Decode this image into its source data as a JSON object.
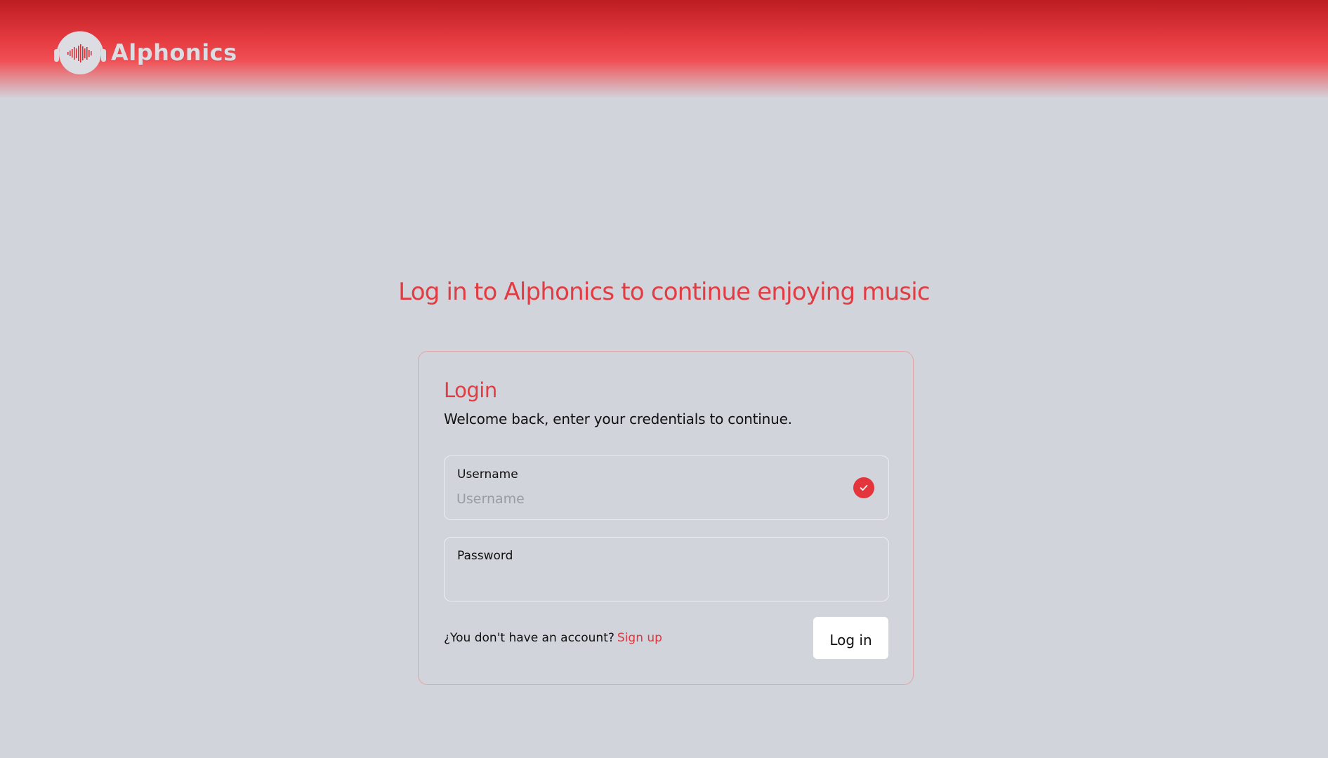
{
  "header": {
    "brand_name": "Alphonics",
    "logo_icon": "headphones-soundwave-icon"
  },
  "page": {
    "heading": "Log in to Alphonics to continue enjoying music"
  },
  "login_card": {
    "title": "Login",
    "subtitle": "Welcome back, enter your credentials to continue.",
    "username": {
      "label": "Username",
      "placeholder": "Username",
      "value": "",
      "status_icon": "check-circle-icon"
    },
    "password": {
      "label": "Password",
      "placeholder": "",
      "value": ""
    },
    "signup_prompt": "¿You don't have an account?",
    "signup_link": "Sign up",
    "submit_label": "Log in"
  },
  "colors": {
    "accent": "#e23c42",
    "header_top": "#bd1d21",
    "background": "#d2d4db",
    "card_border": "#e4a3a7"
  }
}
